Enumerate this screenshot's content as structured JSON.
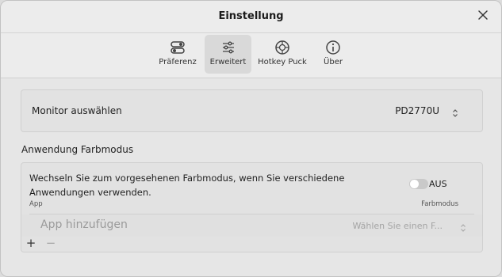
{
  "window": {
    "title": "Einstellung"
  },
  "toolbar": {
    "tabs": [
      {
        "label": "Präferenz",
        "icon": "toggles-icon"
      },
      {
        "label": "Erweitert",
        "icon": "sliders-icon",
        "active": true
      },
      {
        "label": "Hotkey Puck",
        "icon": "puck-icon"
      },
      {
        "label": "Über",
        "icon": "info-icon"
      }
    ]
  },
  "monitor": {
    "label": "Monitor auswählen",
    "value": "PD2770U"
  },
  "app_color_mode": {
    "section_title": "Anwendung Farbmodus",
    "description": "Wechseln Sie zum vorgesehenen Farbmodus, wenn Sie verschiedene Anwendungen verwenden.",
    "toggle_label": "AUS",
    "toggle_on": false,
    "columns": {
      "app": "App",
      "mode": "Farbmodus"
    },
    "row": {
      "app_placeholder": "App hinzufügen",
      "mode_placeholder": "Wählen Sie einen F..."
    },
    "add_label": "+",
    "remove_label": "−"
  },
  "colors": {
    "accent": "#d9d9d9",
    "background": "#e6e6e6"
  }
}
